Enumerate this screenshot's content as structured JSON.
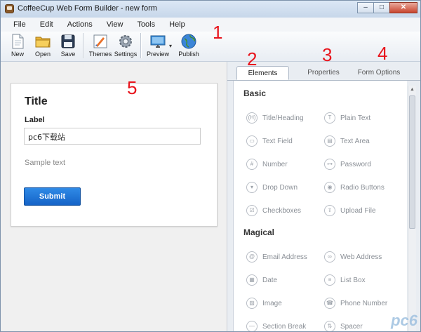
{
  "window": {
    "title": "CoffeeCup Web Form Builder - new form",
    "min": "–",
    "max": "□",
    "close": "✕"
  },
  "menu": [
    "File",
    "Edit",
    "Actions",
    "View",
    "Tools",
    "Help"
  ],
  "toolbar": {
    "new": "New",
    "open": "Open",
    "save": "Save",
    "themes": "Themes",
    "settings": "Settings",
    "preview": "Preview",
    "publish": "Publish"
  },
  "annotations": [
    "1",
    "2",
    "3",
    "4",
    "5"
  ],
  "tabs": {
    "elements": "Elements",
    "properties": "Properties",
    "form_options": "Form Options"
  },
  "form": {
    "title": "Title",
    "label": "Label",
    "input_value": "pc6下载站",
    "sample_text": "Sample text",
    "submit": "Submit"
  },
  "palette": {
    "basic_heading": "Basic",
    "basic": [
      "Title/Heading",
      "Plain Text",
      "Text Field",
      "Text Area",
      "Number",
      "Password",
      "Drop Down",
      "Radio Buttons",
      "Checkboxes",
      "Upload File"
    ],
    "magical_heading": "Magical",
    "magical": [
      "Email Address",
      "Web Address",
      "Date",
      "List Box",
      "Image",
      "Phone Number",
      "Section Break",
      "Spacer"
    ]
  },
  "icons": {
    "basic": [
      "(H)",
      "T",
      "▭",
      "▤",
      "#",
      "⊶",
      "▾",
      "◉",
      "☑",
      "⇪"
    ],
    "magical": [
      "@",
      "∞",
      "▦",
      "≡",
      "▨",
      "☎",
      "—",
      "⇅"
    ]
  },
  "watermark": "pc6"
}
